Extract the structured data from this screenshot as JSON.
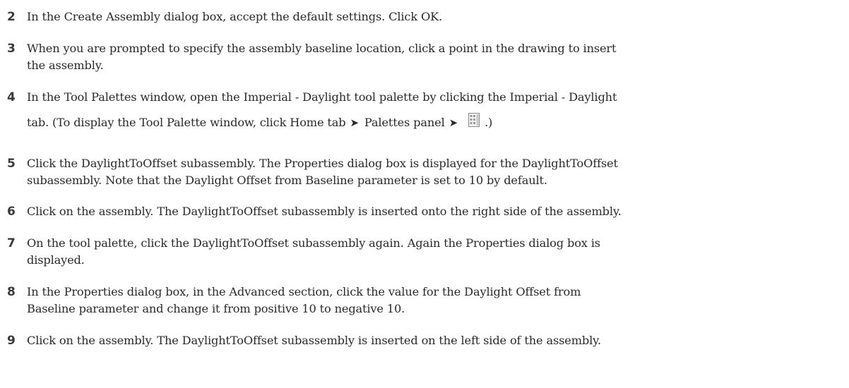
{
  "steps": [
    {
      "number": "2",
      "lines": [
        "In the Create Assembly dialog box, accept the default settings. Click OK."
      ]
    },
    {
      "number": "3",
      "lines": [
        "When you are prompted to specify the assembly baseline location, click a point in the drawing to insert",
        "the assembly."
      ]
    },
    {
      "number": "4",
      "line1": "In the Tool Palettes window, open the Imperial - Daylight tool palette by clicking the Imperial - Daylight",
      "line2_part1": "tab. (To display the Tool Palette window, click Home tab",
      "line2_part2": "Palettes panel",
      "line2_part3": ".)",
      "arrow_glyph": "➤",
      "icon": "tool-palette-icon"
    },
    {
      "number": "5",
      "lines": [
        "Click the DaylightToOffset subassembly. The Properties dialog box is displayed for the DaylightToOffset",
        "subassembly. Note that the Daylight Offset from Baseline parameter is set to 10 by default."
      ]
    },
    {
      "number": "6",
      "lines": [
        "Click on the assembly. The DaylightToOffset subassembly is inserted onto the right side of the assembly."
      ]
    },
    {
      "number": "7",
      "lines": [
        "On the tool palette, click the DaylightToOffset subassembly again. Again the Properties dialog box is",
        "displayed."
      ]
    },
    {
      "number": "8",
      "lines": [
        "In the Properties dialog box, in the Advanced section, click the value for the Daylight Offset from",
        "Baseline parameter and change it from positive 10 to negative 10."
      ]
    },
    {
      "number": "9",
      "lines": [
        "Click on the assembly. The DaylightToOffset subassembly is inserted on the left side of the assembly."
      ]
    }
  ]
}
